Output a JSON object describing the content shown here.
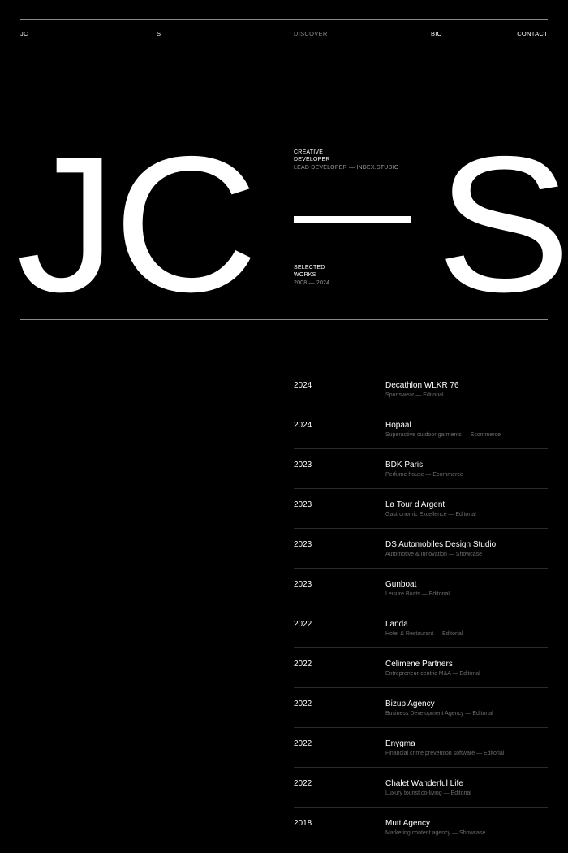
{
  "nav": {
    "initials_left": "JC",
    "initials_right": "S",
    "discover": "DISCOVER",
    "bio": "BIO",
    "contact": "CONTACT"
  },
  "hero": {
    "left_letters": "JC",
    "right_letter": "S",
    "role_line1": "CREATIVE",
    "role_line2": "DEVELOPER",
    "role_line3": "LEAD DEVELOPER — INDEX.STUDIO",
    "works_line1": "SELECTED",
    "works_line2": "WORKS",
    "works_line3": "2008 — 2024"
  },
  "projects": [
    {
      "year": "2024",
      "name": "Decathlon WLKR 76",
      "desc": "Sportswear — Editorial"
    },
    {
      "year": "2024",
      "name": "Hopaal",
      "desc": "Superactive outdoor garments — Ecommerce"
    },
    {
      "year": "2023",
      "name": "BDK Paris",
      "desc": "Perfume house — Ecommerce"
    },
    {
      "year": "2023",
      "name": "La Tour d’Argent",
      "desc": "Gastronomic Excellence — Editorial"
    },
    {
      "year": "2023",
      "name": "DS Automobiles Design Studio",
      "desc": "Automotive & Innovation — Showcase"
    },
    {
      "year": "2023",
      "name": "Gunboat",
      "desc": "Leisure Boats — Editorial"
    },
    {
      "year": "2022",
      "name": "Landa",
      "desc": "Hotel & Restaurant — Editorial"
    },
    {
      "year": "2022",
      "name": "Celimene Partners",
      "desc": "Entrepreneur-centric M&A — Editorial"
    },
    {
      "year": "2022",
      "name": "Bizup Agency",
      "desc": "Business Development Agency — Editorial"
    },
    {
      "year": "2022",
      "name": "Enygma",
      "desc": "Financial crime prevention software — Editorial"
    },
    {
      "year": "2022",
      "name": "Chalet Wanderful Life",
      "desc": "Luxury tourist co-living — Editorial"
    },
    {
      "year": "2018",
      "name": "Mutt Agency",
      "desc": "Marketing content agency — Showcase"
    }
  ],
  "colors": {
    "background": "#000000",
    "text": "#ffffff",
    "muted": "#6d6d6d"
  }
}
